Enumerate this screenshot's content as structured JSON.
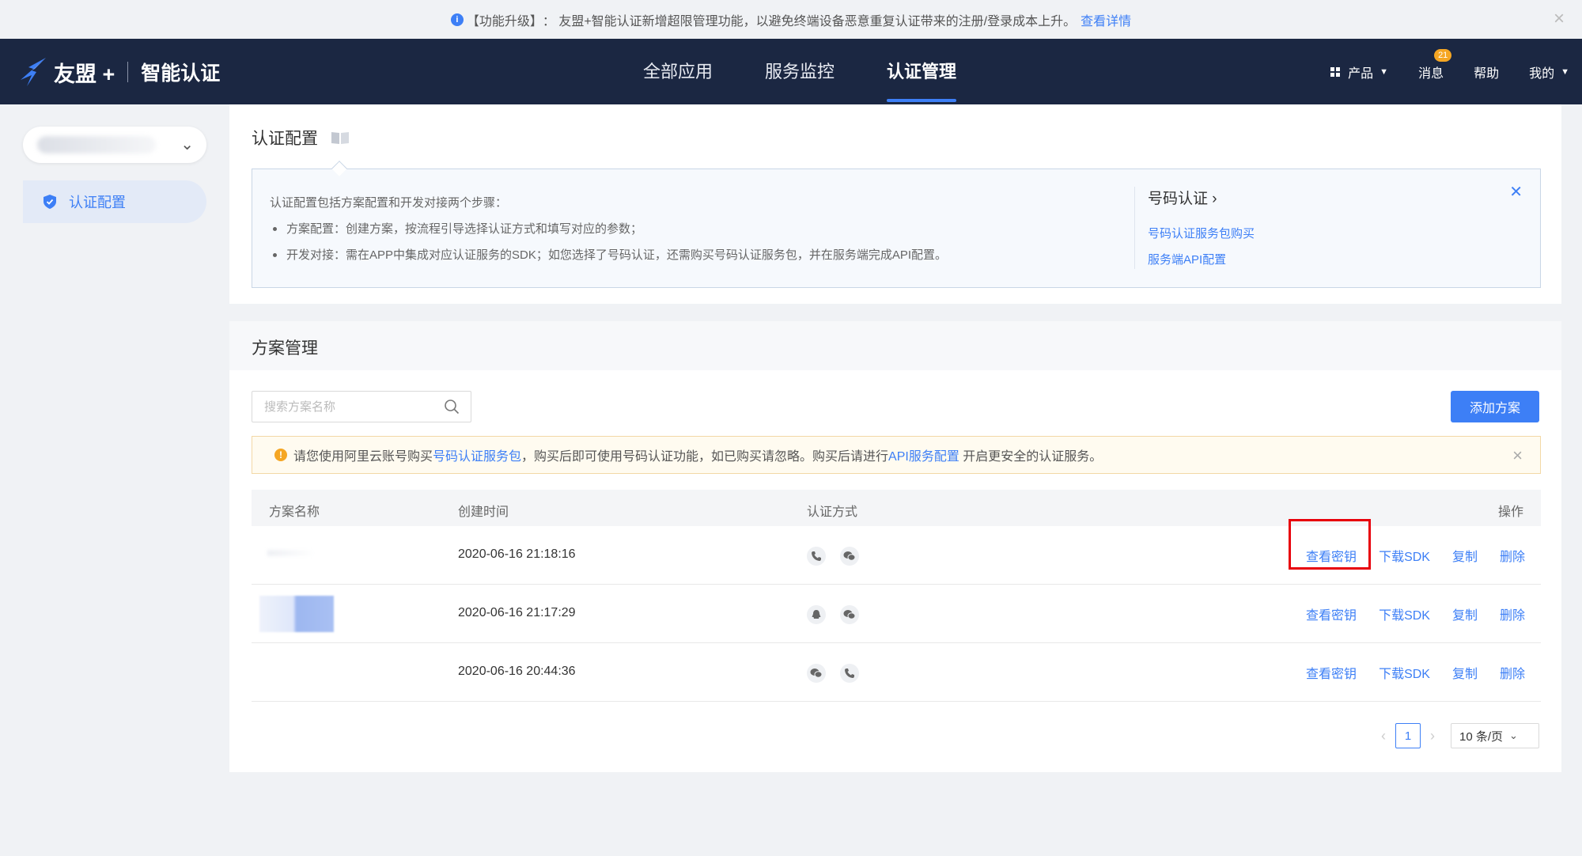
{
  "announcement": {
    "tag": "【功能升级】",
    "text": "： 友盟+智能认证新增超限管理功能，以避免终端设备恶意重复认证带来的注册/登录成本上升。",
    "link": "查看详情"
  },
  "brand": {
    "name": "友盟 +",
    "product": "智能认证"
  },
  "mainnav": {
    "items": [
      "全部应用",
      "服务监控",
      "认证管理"
    ],
    "active_index": 2
  },
  "rightnav": {
    "products": "产品",
    "messages": "消息",
    "messages_badge": "21",
    "help": "帮助",
    "mine": "我的"
  },
  "sidebar": {
    "items": [
      {
        "label": "认证配置",
        "icon": "shield-check-icon",
        "active": true
      }
    ]
  },
  "config_card": {
    "title": "认证配置",
    "intro": "认证配置包括方案配置和开发对接两个步骤：",
    "bullets": [
      "方案配置：创建方案，按流程引导选择认证方式和填写对应的参数；",
      "开发对接：需在APP中集成对应认证服务的SDK；如您选择了号码认证，还需购买号码认证服务包，并在服务端完成API配置。"
    ],
    "side_title": "号码认证",
    "side_links": [
      "号码认证服务包购买",
      "服务端API配置"
    ]
  },
  "plan_card": {
    "title": "方案管理",
    "search_placeholder": "搜索方案名称",
    "add_button": "添加方案",
    "warning": {
      "p1": "请您使用阿里云账号购买",
      "link1": "号码认证服务包",
      "p2": "，购买后即可使用号码认证功能，如已购买请忽略。购买后请进行",
      "link2": "API服务配置",
      "p3": "开启更安全的认证服务。"
    },
    "columns": [
      "方案名称",
      "创建时间",
      "认证方式",
      "操作"
    ],
    "rows": [
      {
        "created": "2020-06-16 21:18:16",
        "methods": [
          "phone-icon",
          "wechat-icon"
        ]
      },
      {
        "created": "2020-06-16 21:17:29",
        "methods": [
          "qq-icon",
          "wechat-icon"
        ]
      },
      {
        "created": "2020-06-16 20:44:36",
        "methods": [
          "wechat-icon",
          "phone-icon"
        ]
      }
    ],
    "ops": {
      "view_key": "查看密钥",
      "download_sdk": "下载SDK",
      "copy": "复制",
      "delete": "删除"
    },
    "pagination": {
      "current_page": "1",
      "page_size": "10 条/页"
    }
  },
  "colors": {
    "nav_bg": "#1b2742",
    "accent": "#3d7ff6",
    "warning": "#f5a623",
    "highlight": "#e8000b"
  }
}
